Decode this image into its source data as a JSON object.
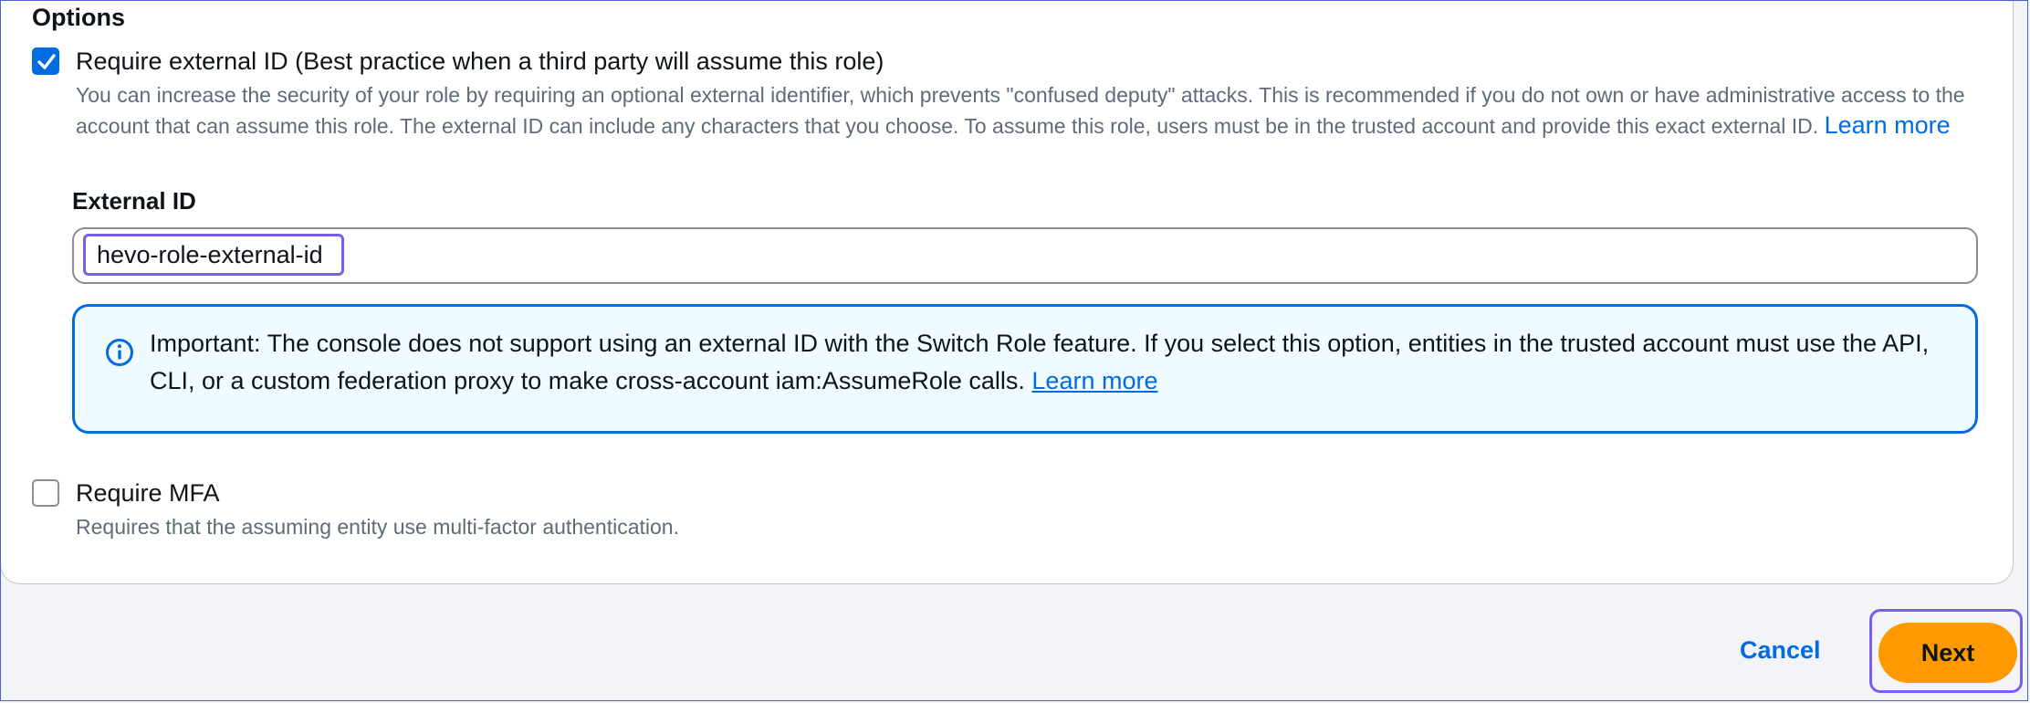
{
  "options": {
    "heading": "Options",
    "external_id_option": {
      "checked": true,
      "label": "Require external ID (Best practice when a third party will assume this role)",
      "description": "You can increase the security of your role by requiring an optional external identifier, which prevents \"confused deputy\" attacks. This is recommended if you do not own or have administrative access to the account that can assume this role. The external ID can include any characters that you choose. To assume this role, users must be in the trusted account and provide this exact external ID.",
      "learn_more": "Learn more"
    },
    "external_id_field": {
      "label": "External ID",
      "value": "hevo-role-external-id"
    },
    "alert": {
      "icon": "info-circle-icon",
      "text": "Important: The console does not support using an external ID with the Switch Role feature. If you select this option, entities in the trusted account must use the API, CLI, or a custom federation proxy to make cross-account iam:AssumeRole calls.",
      "learn_more": "Learn more"
    },
    "mfa_option": {
      "checked": false,
      "label": "Require MFA",
      "description": "Requires that the assuming entity use multi-factor authentication."
    }
  },
  "footer": {
    "cancel_label": "Cancel",
    "next_label": "Next"
  },
  "colors": {
    "accent": "#006ce0",
    "primary_button": "#ff9900",
    "focus_ring": "#7b5cf0",
    "alert_background": "#f0fbff"
  }
}
